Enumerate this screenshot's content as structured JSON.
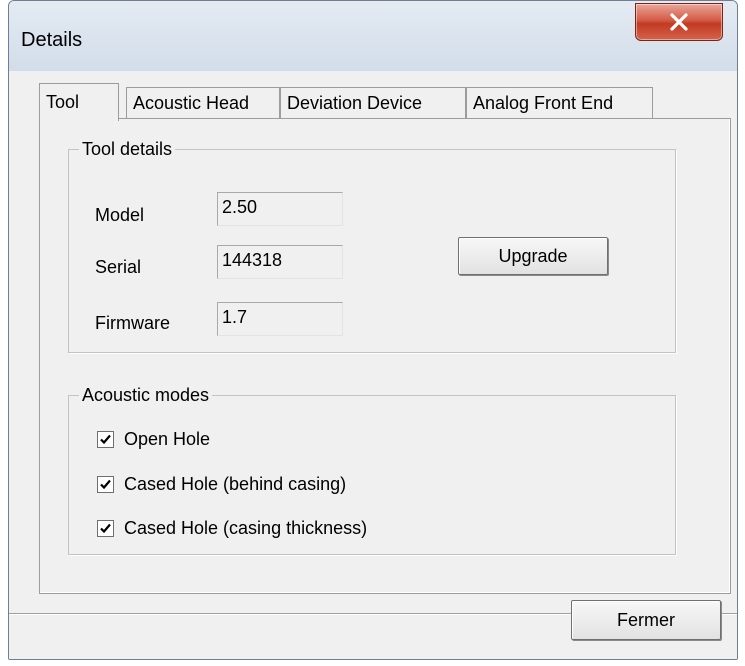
{
  "window": {
    "title": "Details"
  },
  "tabs": [
    {
      "label": "Tool",
      "active": true
    },
    {
      "label": "Acoustic Head",
      "active": false
    },
    {
      "label": "Deviation Device",
      "active": false
    },
    {
      "label": "Analog Front End",
      "active": false
    }
  ],
  "tool_details": {
    "legend": "Tool details",
    "model_label": "Model",
    "model_value": "2.50",
    "serial_label": "Serial",
    "serial_value": "144318",
    "firmware_label": "Firmware",
    "firmware_value": "1.7",
    "upgrade_label": "Upgrade"
  },
  "acoustic_modes": {
    "legend": "Acoustic modes",
    "options": [
      {
        "label": "Open Hole",
        "checked": true
      },
      {
        "label": "Cased Hole (behind casing)",
        "checked": true
      },
      {
        "label": "Cased Hole (casing thickness)",
        "checked": true
      }
    ]
  },
  "footer": {
    "close_label": "Fermer"
  },
  "icons": {
    "close": "close-x-icon",
    "check": "checkmark-icon"
  }
}
